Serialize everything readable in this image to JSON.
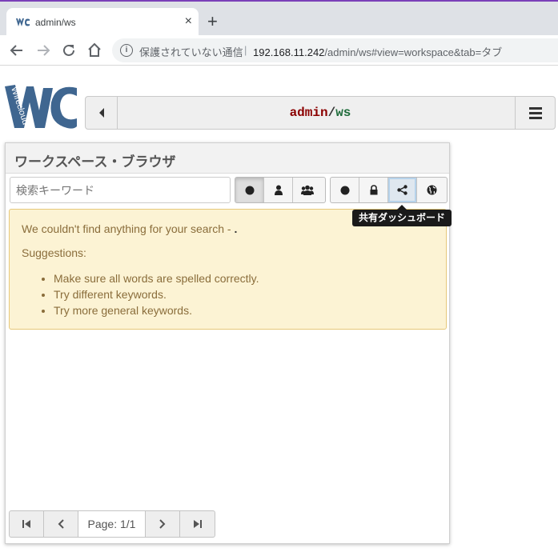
{
  "browser": {
    "tab_title": "admin/ws",
    "tab_close": "×",
    "new_tab": "+",
    "insecure_label": "保護されていない通信",
    "separator": "|",
    "url_host": "192.168.11.242",
    "url_path": "/admin/ws#view=workspace&tab=タブ"
  },
  "logo": {
    "text": "Wirecloud",
    "color": "#3f6690"
  },
  "header": {
    "owner": "admin",
    "slash": "/",
    "workspace": "ws",
    "owner_color": "#8b0000",
    "name_color": "#1e6b3a"
  },
  "panel": {
    "title": "ワークスペース・ブラウザ",
    "search_placeholder": "検索キーワード",
    "filter_group_1": [
      "all-circle-icon",
      "user-icon",
      "group-icon"
    ],
    "filter_group_2": [
      "all-circle-icon",
      "lock-icon",
      "share-icon",
      "globe-icon"
    ],
    "tooltip": "共有ダッシュボード"
  },
  "alert": {
    "message": "We couldn't find anything for your search - ",
    "query": ".",
    "suggestions_title": "Suggestions:",
    "suggestions": [
      "Make sure all words are spelled correctly.",
      "Try different keywords.",
      "Try more general keywords."
    ]
  },
  "pagination": {
    "page_label": "Page: 1/1"
  }
}
